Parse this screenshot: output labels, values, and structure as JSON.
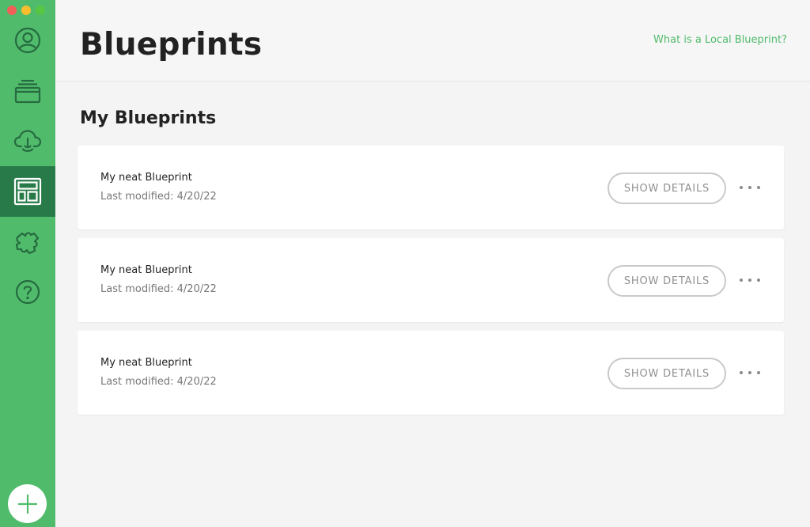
{
  "window": {
    "controls": [
      "close",
      "minimize",
      "zoom"
    ]
  },
  "sidebar": {
    "items": [
      {
        "icon": "user-icon",
        "active": false
      },
      {
        "icon": "sites-stack-icon",
        "active": false
      },
      {
        "icon": "cloud-icon",
        "active": false
      },
      {
        "icon": "blueprint-icon",
        "active": true
      },
      {
        "icon": "addons-puzzle-icon",
        "active": false
      },
      {
        "icon": "help-icon",
        "active": false
      }
    ],
    "add_button_icon": "plus-icon"
  },
  "header": {
    "title": "Blueprints",
    "help_link": "What is a Local Blueprint?"
  },
  "main": {
    "section_title": "My Blueprints",
    "blueprints": [
      {
        "name": "My neat Blueprint",
        "modified": "Last modified: 4/20/22",
        "action_label": "SHOW DETAILS",
        "menu_icon": "more-dots-icon"
      },
      {
        "name": "My neat Blueprint",
        "modified": "Last modified: 4/20/22",
        "action_label": "SHOW DETAILS",
        "menu_icon": "more-dots-icon"
      },
      {
        "name": "My neat Blueprint",
        "modified": "Last modified: 4/20/22",
        "action_label": "SHOW DETAILS",
        "menu_icon": "more-dots-icon"
      }
    ]
  },
  "colors": {
    "sidebar": "#51bb6c",
    "sidebar_active": "#287b48",
    "accent": "#51bb6c",
    "background": "#f4f4f4"
  }
}
